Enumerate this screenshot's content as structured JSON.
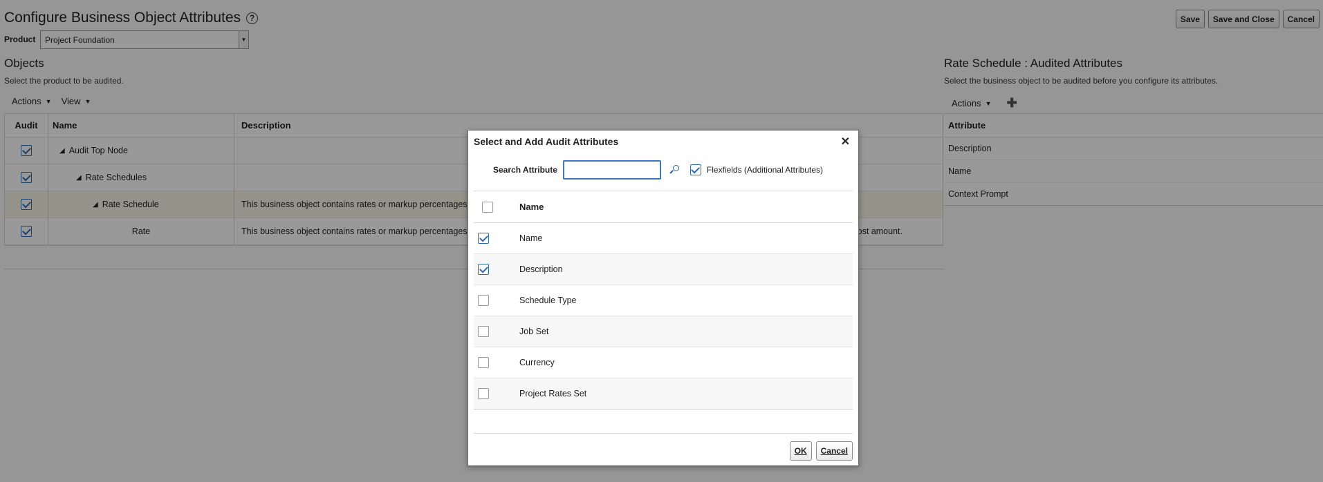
{
  "page": {
    "title": "Configure Business Object Attributes",
    "help_icon": "?",
    "buttons": {
      "save": "Save",
      "save_close": "Save and Close",
      "cancel": "Cancel"
    },
    "product_label": "Product",
    "product_value": "Project Foundation"
  },
  "objects": {
    "title": "Objects",
    "subtitle": "Select the product to be audited.",
    "actions": "Actions",
    "view": "View",
    "columns": {
      "audit": "Audit",
      "name": "Name",
      "description": "Description"
    },
    "rows": [
      {
        "name": "Audit Top Node",
        "description": "",
        "checked": true
      },
      {
        "name": "Rate Schedules",
        "description": "",
        "checked": true
      },
      {
        "name": "Rate Schedule",
        "description": "This business object contains rates or markup percentages fo",
        "checked": true
      },
      {
        "name": "Rate",
        "description": "This business object contains rates or markup percentages to",
        "tail": "ost amount.",
        "checked": true
      }
    ]
  },
  "audited": {
    "title": "Rate Schedule : Audited Attributes",
    "subtitle": "Select the business object to be audited before you configure its attributes.",
    "actions": "Actions",
    "column": "Attribute",
    "rows": [
      "Description",
      "Name",
      "Context Prompt"
    ]
  },
  "dialog": {
    "title": "Select and Add Audit Attributes",
    "close": "✕",
    "search_label": "Search Attribute",
    "search_value": "",
    "flexfields_label": "Flexfields (Additional Attributes)",
    "flexfields_checked": true,
    "column": "Name",
    "rows": [
      {
        "name": "Name",
        "checked": true
      },
      {
        "name": "Description",
        "checked": true
      },
      {
        "name": "Schedule Type",
        "checked": false
      },
      {
        "name": "Job Set",
        "checked": false
      },
      {
        "name": "Currency",
        "checked": false
      },
      {
        "name": "Project Rates Set",
        "checked": false
      }
    ],
    "ok": "OK",
    "cancel": "Cancel"
  }
}
